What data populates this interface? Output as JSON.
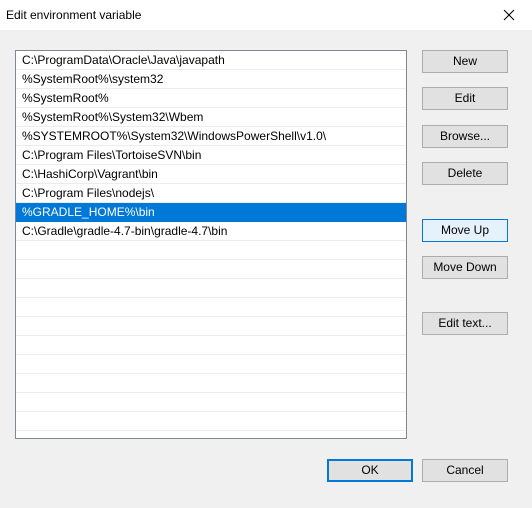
{
  "dialog": {
    "title": "Edit environment variable"
  },
  "path_list": {
    "selected_index": 8,
    "items": [
      "C:\\ProgramData\\Oracle\\Java\\javapath",
      "%SystemRoot%\\system32",
      "%SystemRoot%",
      "%SystemRoot%\\System32\\Wbem",
      "%SYSTEMROOT%\\System32\\WindowsPowerShell\\v1.0\\",
      "C:\\Program Files\\TortoiseSVN\\bin",
      "C:\\HashiCorp\\Vagrant\\bin",
      "C:\\Program Files\\nodejs\\",
      "%GRADLE_HOME%\\bin",
      "C:\\Gradle\\gradle-4.7-bin\\gradle-4.7\\bin"
    ]
  },
  "buttons": {
    "new": "New",
    "edit": "Edit",
    "browse": "Browse...",
    "delete": "Delete",
    "move_up": "Move Up",
    "move_down": "Move Down",
    "edit_text": "Edit text...",
    "ok": "OK",
    "cancel": "Cancel"
  },
  "icons": {
    "close": "close-icon"
  },
  "colors": {
    "selection": "#0078d7",
    "button_face": "#e1e1e1",
    "button_border": "#adadad",
    "dialog_background": "#f0f0f0"
  }
}
